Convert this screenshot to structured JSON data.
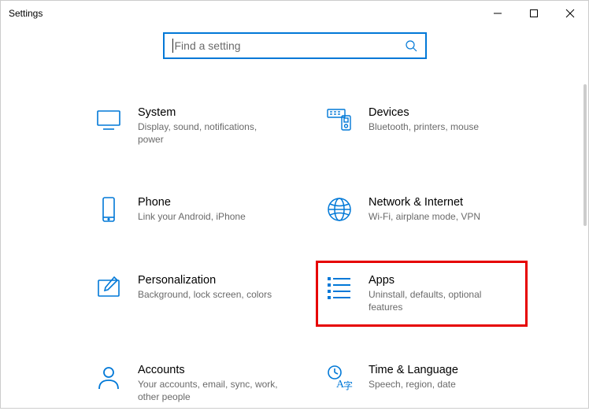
{
  "window": {
    "title": "Settings"
  },
  "search": {
    "placeholder": "Find a setting"
  },
  "categories": {
    "system": {
      "title": "System",
      "desc": "Display, sound, notifications, power"
    },
    "devices": {
      "title": "Devices",
      "desc": "Bluetooth, printers, mouse"
    },
    "phone": {
      "title": "Phone",
      "desc": "Link your Android, iPhone"
    },
    "network": {
      "title": "Network & Internet",
      "desc": "Wi-Fi, airplane mode, VPN"
    },
    "personalization": {
      "title": "Personalization",
      "desc": "Background, lock screen, colors"
    },
    "apps": {
      "title": "Apps",
      "desc": "Uninstall, defaults, optional features"
    },
    "accounts": {
      "title": "Accounts",
      "desc": "Your accounts, email, sync, work, other people"
    },
    "time": {
      "title": "Time & Language",
      "desc": "Speech, region, date"
    }
  },
  "colors": {
    "accent": "#0078d7",
    "highlight_border": "#e60000"
  }
}
